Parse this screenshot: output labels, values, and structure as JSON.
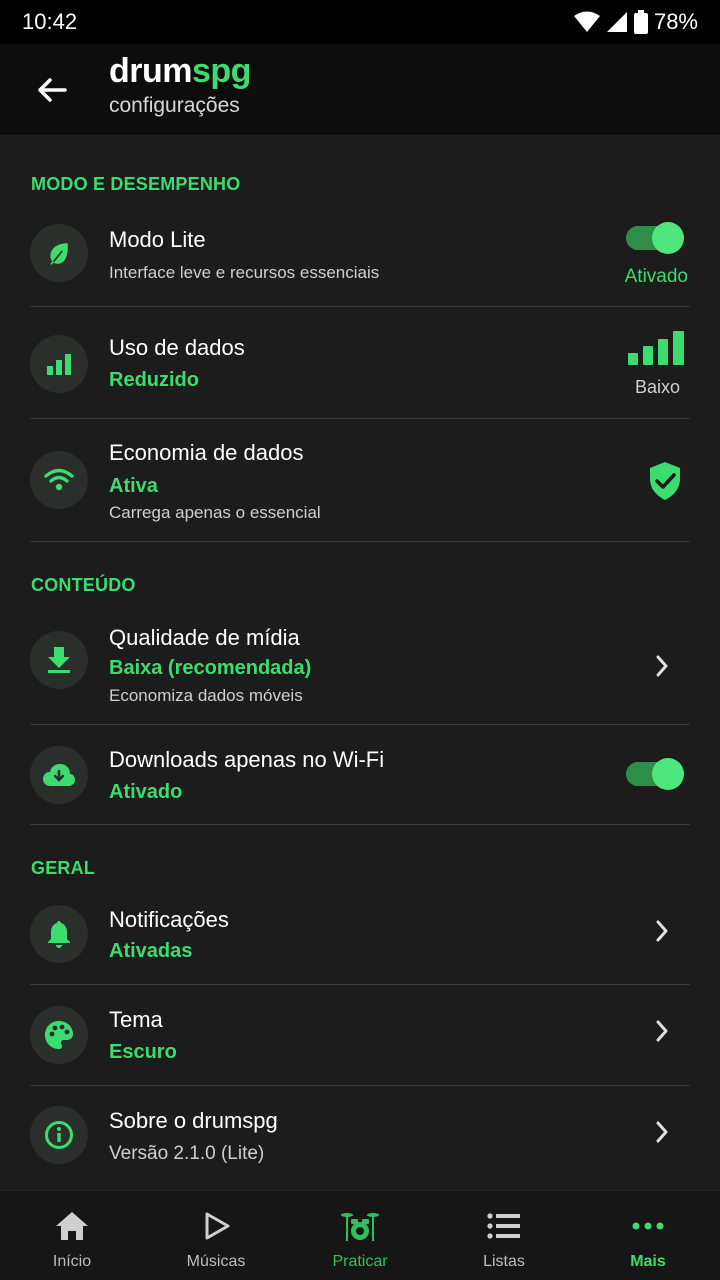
{
  "status_bar": {
    "time": "10:42",
    "battery": "78%"
  },
  "header": {
    "brand_part1": "drum",
    "brand_part2": "spg",
    "subtitle": "configurações"
  },
  "sections": {
    "performance": {
      "title": "MODO E DESEMPENHO",
      "lite": {
        "title": "Modo Lite",
        "desc": "Interface leve e recursos essenciais",
        "state_label": "Ativado",
        "enabled": true
      },
      "data_usage": {
        "title": "Uso de dados",
        "value": "Reduzido",
        "level_label": "Baixo"
      },
      "data_saver": {
        "title": "Economia de dados",
        "value": "Ativa",
        "desc": "Carrega apenas o essencial"
      }
    },
    "content": {
      "title": "CONTEÚDO",
      "media_quality": {
        "title": "Qualidade de mídia",
        "value": "Baixa (recomendada)",
        "desc": "Economiza dados móveis"
      },
      "wifi_downloads": {
        "title": "Downloads apenas no Wi-Fi",
        "value": "Ativado",
        "enabled": true
      }
    },
    "general": {
      "title": "GERAL",
      "notifications": {
        "title": "Notificações",
        "value": "Ativadas"
      },
      "theme": {
        "title": "Tema",
        "value": "Escuro"
      },
      "about": {
        "title": "Sobre o drumspg",
        "desc": "Versão 2.1.0 (Lite)"
      }
    }
  },
  "bottom_nav": {
    "home": "Início",
    "songs": "Músicas",
    "practice": "Praticar",
    "lists": "Listas",
    "more": "Mais"
  },
  "colors": {
    "accent": "#3ddc6f",
    "background": "#1c1c1c",
    "appbar": "#0d0d0d"
  },
  "icons": [
    "arrow-back-icon",
    "leaf-icon",
    "signal-bars-icon",
    "wifi-icon",
    "shield-check-icon",
    "download-icon",
    "cloud-download-icon",
    "bell-icon",
    "palette-icon",
    "info-icon",
    "chevron-right-icon",
    "home-icon",
    "play-icon",
    "drum-kit-icon",
    "list-icon",
    "more-dots-icon"
  ]
}
